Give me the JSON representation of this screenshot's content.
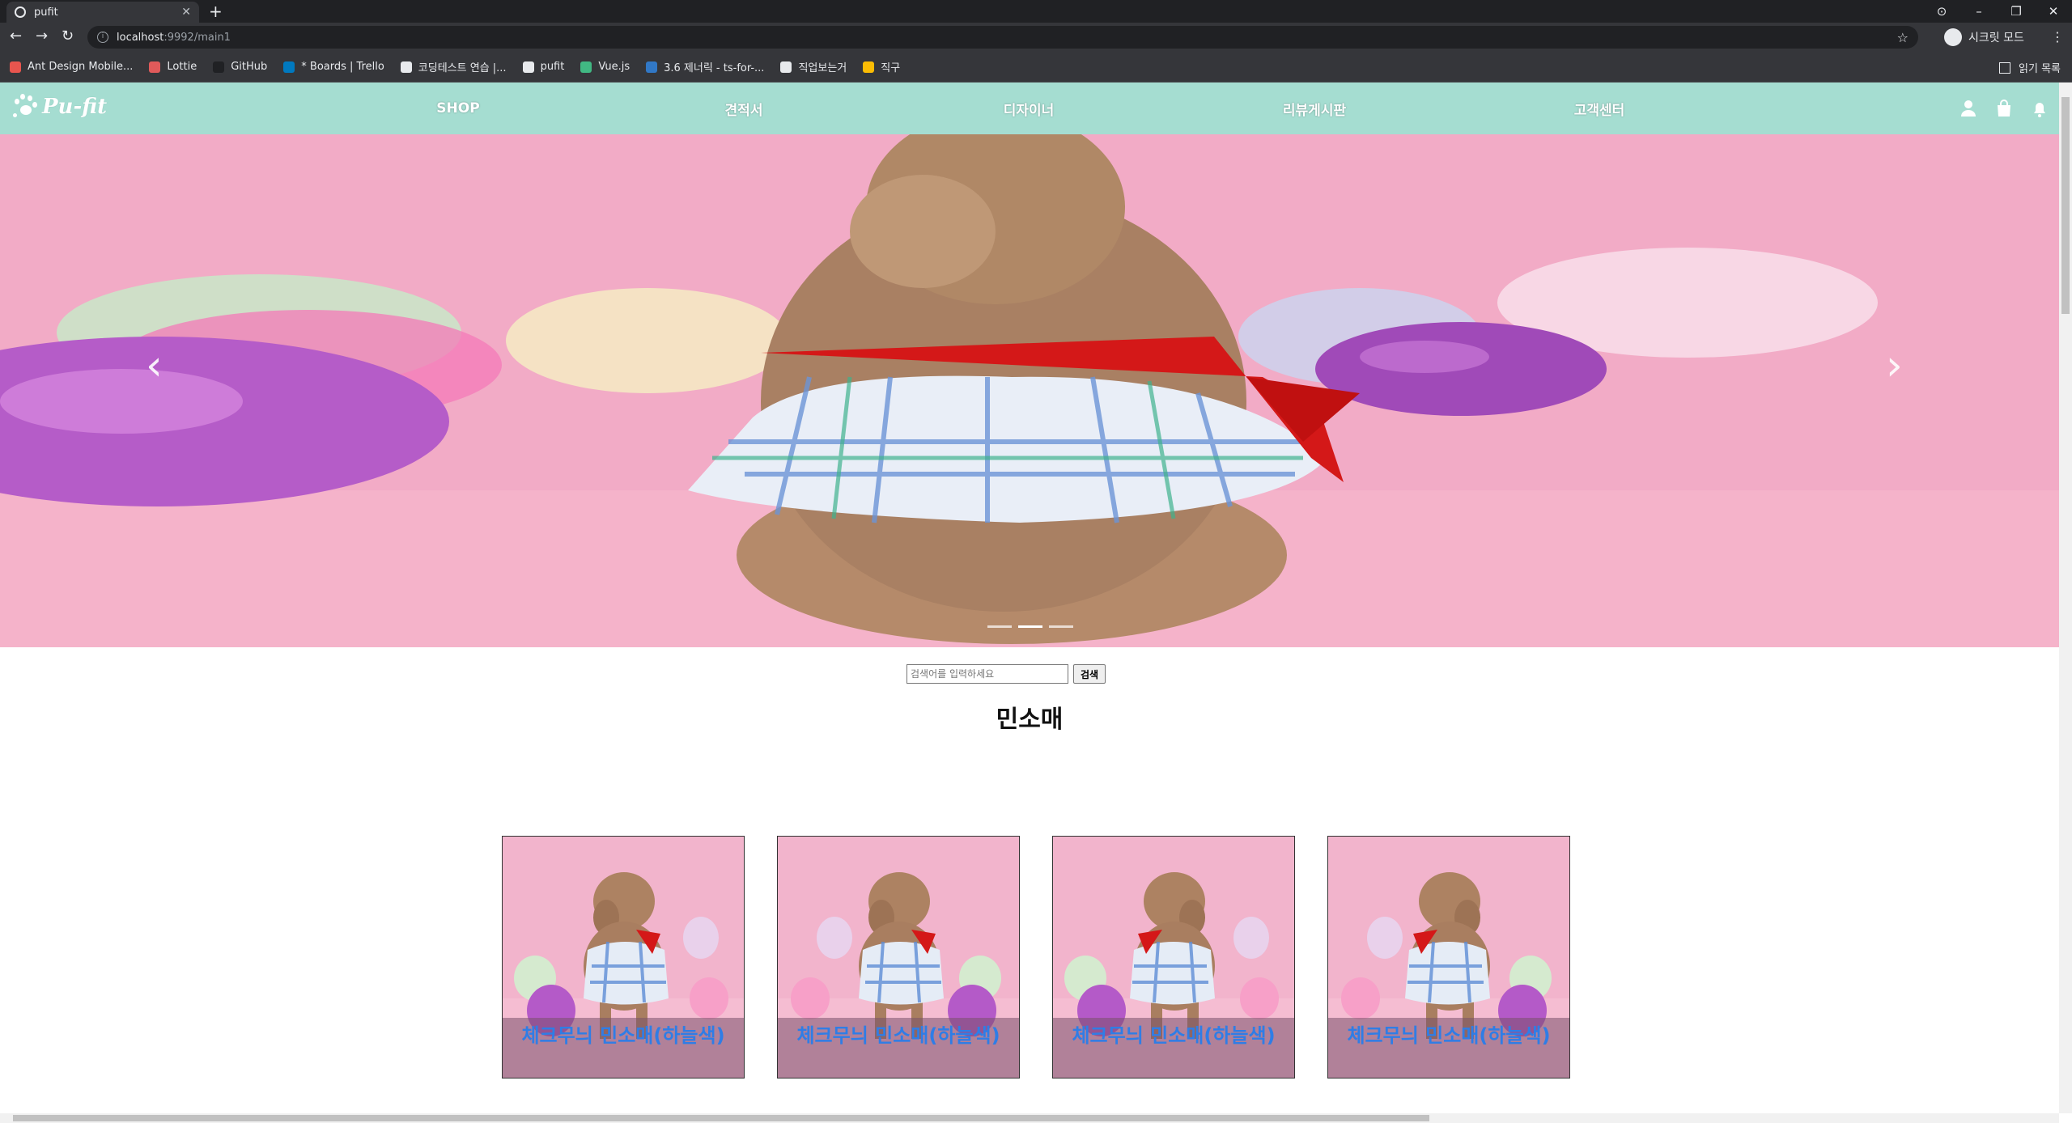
{
  "browser": {
    "tab_title": "pufit",
    "url_host": "localhost",
    "url_path": ":9992/main1",
    "incognito_label": "시크릿 모드",
    "reading_list_label": "읽기 목록",
    "bookmarks": [
      {
        "label": "Ant Design Mobile...",
        "color": "#e8554e"
      },
      {
        "label": "Lottie",
        "color": "#e05a5a"
      },
      {
        "label": "GitHub",
        "color": "#202124"
      },
      {
        "label": "* Boards | Trello",
        "color": "#0079bf"
      },
      {
        "label": "코딩테스트 연습 |...",
        "color": "#e8eaed"
      },
      {
        "label": "pufit",
        "color": "#e8eaed"
      },
      {
        "label": "Vue.js",
        "color": "#41b883"
      },
      {
        "label": "3.6 제너릭 - ts-for-...",
        "color": "#3178c6"
      },
      {
        "label": "직업보는거",
        "color": "#e8eaed"
      },
      {
        "label": "직구",
        "color": "#fbbc04"
      }
    ]
  },
  "site": {
    "logo_text": "Pu-fit",
    "nav": [
      "SHOP",
      "견적서",
      "디자이너",
      "리뷰게시판",
      "고객센터"
    ],
    "header_icons": [
      "user-icon",
      "shopping-bag-icon",
      "bell-icon"
    ],
    "colors": {
      "header_bg": "#a5ddd1",
      "hero_bg": "#f2abc6",
      "caption_text": "#2f7de6"
    }
  },
  "hero": {
    "slide_count": 3,
    "active_slide": 1
  },
  "search": {
    "placeholder": "검색어를 입력하세요",
    "button_label": "검색"
  },
  "section_title": "민소매",
  "products": [
    {
      "name": "체크무늬 민소매(하늘색)"
    },
    {
      "name": "체크무늬 민소매(하늘색)"
    },
    {
      "name": "체크무늬 민소매(하늘색)"
    },
    {
      "name": "체크무늬 민소매(하늘색)"
    }
  ]
}
